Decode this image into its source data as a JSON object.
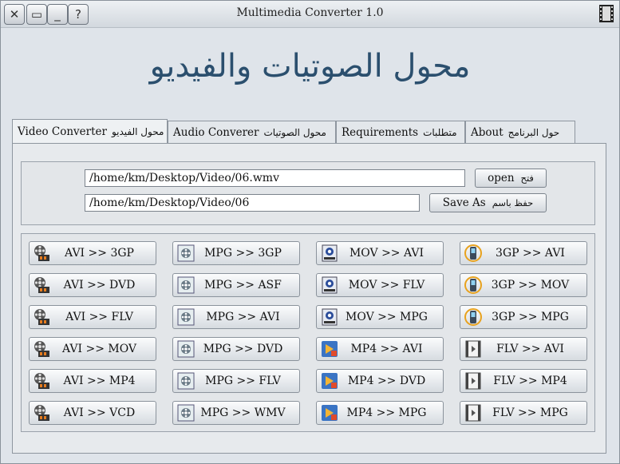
{
  "window": {
    "title": "Multimedia Converter 1.0"
  },
  "titlebar_buttons": [
    "close-icon",
    "restore-icon",
    "minimize-icon",
    "help-icon"
  ],
  "heading": "محول الصوتيات والفيديو",
  "tabs": [
    {
      "label": "Video Converter",
      "ar": "محول الفيديو",
      "active": true
    },
    {
      "label": "Audio Converer",
      "ar": "محول الصوتيات",
      "active": false
    },
    {
      "label": "Requirements",
      "ar": "متطلبات",
      "active": false
    },
    {
      "label": "About",
      "ar": "حول البرنامج",
      "active": false
    }
  ],
  "file": {
    "input_path": "/home/km/Desktop/Video/06.wmv",
    "output_path": "/home/km/Desktop/Video/06",
    "open_label": "open",
    "open_ar": "فتح",
    "saveas_label": "Save As",
    "saveas_ar": "حفظ باسم"
  },
  "converters": [
    [
      {
        "label": "AVI >> 3GP",
        "icon": "film-reel-icon"
      },
      {
        "label": "AVI >> DVD",
        "icon": "film-reel-icon"
      },
      {
        "label": "AVI >> FLV",
        "icon": "film-reel-icon"
      },
      {
        "label": "AVI >> MOV",
        "icon": "film-reel-icon"
      },
      {
        "label": "AVI >> MP4",
        "icon": "film-reel-icon"
      },
      {
        "label": "AVI >> VCD",
        "icon": "film-reel-icon"
      }
    ],
    [
      {
        "label": "MPG >> 3GP",
        "icon": "mpg-reel-icon"
      },
      {
        "label": "MPG >> ASF",
        "icon": "mpg-reel-icon"
      },
      {
        "label": "MPG >> AVI",
        "icon": "mpg-reel-icon"
      },
      {
        "label": "MPG >> DVD",
        "icon": "mpg-reel-icon"
      },
      {
        "label": "MPG >> FLV",
        "icon": "mpg-reel-icon"
      },
      {
        "label": "MPG >> WMV",
        "icon": "mpg-reel-icon"
      }
    ],
    [
      {
        "label": "MOV >> AVI",
        "icon": "quicktime-icon"
      },
      {
        "label": "MOV >> FLV",
        "icon": "quicktime-icon"
      },
      {
        "label": "MOV >> MPG",
        "icon": "quicktime-icon"
      },
      {
        "label": "MP4 >> AVI",
        "icon": "mp4-media-icon"
      },
      {
        "label": "MP4 >> DVD",
        "icon": "mp4-media-icon"
      },
      {
        "label": "MP4 >> MPG",
        "icon": "mp4-media-icon"
      }
    ],
    [
      {
        "label": "3GP >> AVI",
        "icon": "mobile-phone-icon"
      },
      {
        "label": "3GP >> MOV",
        "icon": "mobile-phone-icon"
      },
      {
        "label": "3GP >> MPG",
        "icon": "mobile-phone-icon"
      },
      {
        "label": "FLV >> AVI",
        "icon": "flash-video-icon"
      },
      {
        "label": "FLV >> MP4",
        "icon": "flash-video-icon"
      },
      {
        "label": "FLV >> MPG",
        "icon": "flash-video-icon"
      }
    ]
  ],
  "colors": {
    "heading": "#2b4f6e",
    "background": "#dfe4ea"
  }
}
